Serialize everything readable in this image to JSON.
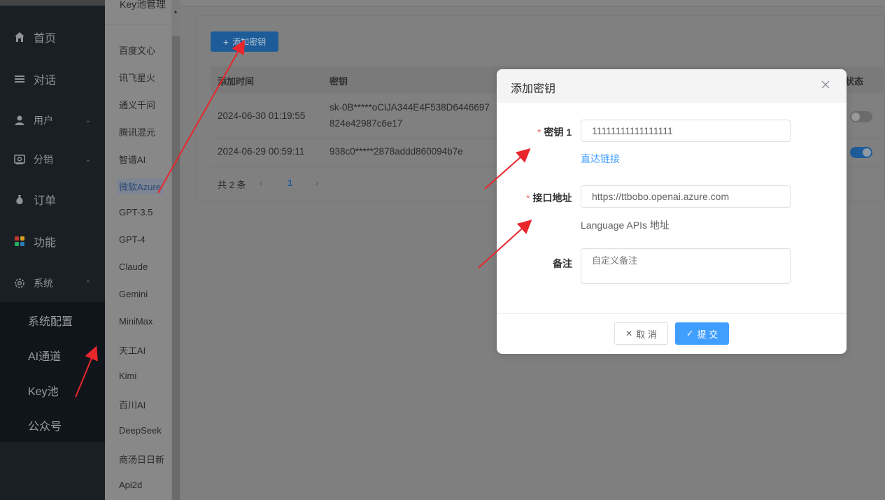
{
  "nav": {
    "items": [
      {
        "label": "首页",
        "icon": "home-icon"
      },
      {
        "label": "对话",
        "icon": "list-icon"
      },
      {
        "label": "用户",
        "icon": "user-icon"
      },
      {
        "label": "分销",
        "icon": "distribution-icon"
      },
      {
        "label": "订单",
        "icon": "money-bag-icon"
      },
      {
        "label": "功能",
        "icon": "apps-icon"
      },
      {
        "label": "系统",
        "icon": "settings-icon"
      }
    ],
    "submenu": [
      "系统配置",
      "AI通道",
      "Key池",
      "公众号"
    ]
  },
  "keycol": {
    "header": "Key池管理",
    "items": [
      "百度文心",
      "讯飞星火",
      "通义千问",
      "腾讯混元",
      "智谱AI",
      "微软Azure",
      "GPT-3.5",
      "GPT-4",
      "Claude",
      "Gemini",
      "MiniMax",
      "天工AI",
      "Kimi",
      "百川AI",
      "DeepSeek",
      "商汤日日新",
      "Api2d"
    ],
    "active": "微软Azure"
  },
  "main": {
    "add_button": "添加密钥",
    "columns": {
      "time": "添加时间",
      "key": "密钥",
      "status": "状态"
    },
    "rows": [
      {
        "time": "2024-06-30 01:19:55",
        "key_line1": "sk-0B*****oClJA344E4F538D6446697",
        "key_line2": "824e42987c6e17",
        "enabled": false
      },
      {
        "time": "2024-06-29 00:59:11",
        "key_line1": "938c0*****2878addd860094b7e",
        "key_line2": "",
        "enabled": true
      }
    ],
    "total": "共 2 条",
    "page": "1"
  },
  "modal": {
    "title": "添加密钥",
    "key_label": "密钥 1",
    "key_value": "11111111111111111",
    "direct_link": "直达链接",
    "endpoint_label": "接口地址",
    "endpoint_value": "https://ttbobo.openai.azure.com",
    "endpoint_hint": "Language APIs 地址",
    "note_label": "备注",
    "note_placeholder": "自定义备注",
    "cancel": "取 消",
    "submit": "提 交"
  },
  "colors": {
    "primary": "#409eff",
    "required": "#f56c6c",
    "annotation_arrow": "#e8262c"
  }
}
